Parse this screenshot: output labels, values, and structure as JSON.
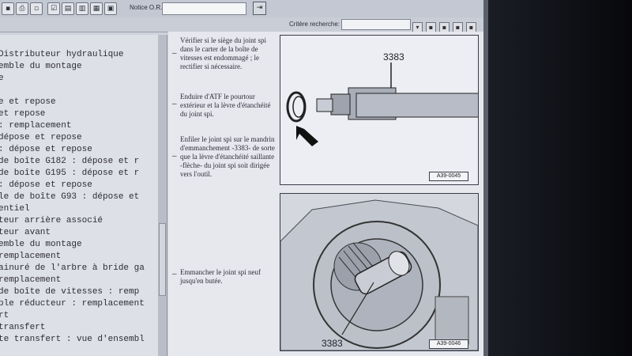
{
  "toolbar": {
    "notice_label": "Notice O.R.",
    "notice_value": ""
  },
  "search": {
    "label": "Critère recherche:",
    "value": ""
  },
  "tree": [
    "Distributeur hydraulique",
    "emble du montage",
    "e",
    "",
    "e et repose",
    " et repose",
    " : remplacement",
    "dépose et repose",
    " : dépose et repose",
    "de boîte  G182  : dépose et r",
    "de boîte G195  : dépose et r",
    ": dépose et repose",
    "le de boîte G93  : dépose et",
    "entiel",
    "teur arrière associé",
    "teur avant",
    "emble du montage",
    "  remplacement",
    "ainuré de l'arbre à bride ga",
    "  remplacement",
    " de boîte de vitesses : remp",
    "ple réducteur : remplacement",
    "rt",
    " transfert",
    "te transfert : vue d'ensembl"
  ],
  "instructions": {
    "p1": "Vérifier si le siège du joint spi dans le carter de la boîte de vitesses est endommagé ; le rectifier si nécessaire.",
    "p2": "Enduire d'ATF le pourtour extérieur et la lèvre d'étanchéité du joint spi.",
    "p3": "Enfiler le joint spi sur le mandrin d'emmanchement -3383- de sorte que la lèvre d'étanchéité saillante -flèche- du joint spi soit dirigée vers l'outil.",
    "p4": "Emmancher le joint spi neuf jusqu'en butée."
  },
  "figures": {
    "fig1_part": "3383",
    "fig1_ref": "A39-0045",
    "fig2_part": "3383",
    "fig2_ref": "A39-0046"
  },
  "colors": {
    "screen_bg": "#cfd3dc",
    "doc_bg": "#e6e8ee",
    "text": "#2f2b36"
  }
}
